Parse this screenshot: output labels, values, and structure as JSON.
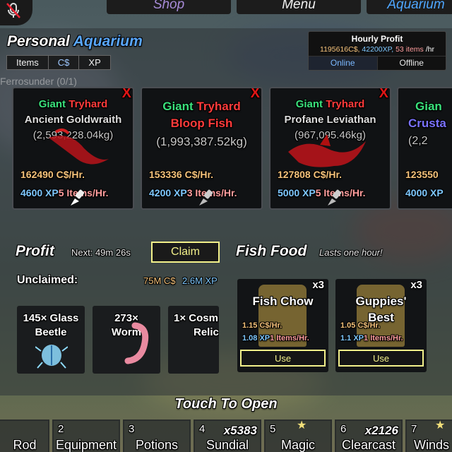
{
  "nav": {
    "shop_label": "Shop",
    "menu_label": "Menu",
    "aquarium_label": "Aquarium"
  },
  "aquarium": {
    "title_personal": "Personal",
    "title_aquarium": "Aquarium",
    "tabs": [
      "Items",
      "C$",
      "XP"
    ],
    "quest_text": "Ferrosunder (0/1)"
  },
  "hourly": {
    "title": "Hourly Profit",
    "cash": "1195616C$,",
    "xp": "42200XP,",
    "items": "53 items",
    "per": "/hr",
    "online_label": "Online",
    "offline_label": "Offline"
  },
  "fish_cards": [
    {
      "mutation1": "Giant",
      "mutation2": "Tryhard",
      "name": "Ancient Goldwraith",
      "weight": "(2,5​93,228.04kg)",
      "profit": "162490 C$/Hr.",
      "xp": "4600 XP",
      "items": "5 Items/Hr.",
      "close": "X"
    },
    {
      "mutation1": "Giant",
      "mutation2": "Tryhard",
      "name": "Bloop Fish",
      "weight": "(1,993,387.52kg)",
      "profit": "153336 C$/Hr.",
      "xp": "4200 XP",
      "items": "3 Items/Hr.",
      "close": "X"
    },
    {
      "mutation1": "Giant",
      "mutation2": "Tryhard",
      "name": "Profane Leviathan",
      "weight": "(967,095.46kg)",
      "profit": "127808 C$/Hr.",
      "xp": "5000 XP",
      "items": "5 Items/Hr.",
      "close": "X"
    },
    {
      "mutation1": "Gian",
      "mutation2": "",
      "name": "Crusta",
      "weight": "(2,2",
      "profit": "123550",
      "xp": "4000 XP",
      "items": "",
      "close": ""
    }
  ],
  "profit": {
    "title": "Profit",
    "next": "Next: 49m 26s",
    "claim_label": "Claim",
    "unclaimed_label": "Unclaimed:",
    "unclaimed_cash": "75M C$",
    "unclaimed_xp": "2.6M XP",
    "loot": [
      {
        "line1": "145× Glass",
        "line2": "Beetle"
      },
      {
        "line1": "273×",
        "line2": "Worm"
      },
      {
        "line1": "1× Cosm",
        "line2": "Relic"
      }
    ]
  },
  "fish_food": {
    "title": "Fish Food",
    "subtitle": "Lasts one hour!",
    "items": [
      {
        "qty": "x3",
        "name": "Fish Chow",
        "cash": "1.15 C$/Hr.",
        "xp": "1.08 XP",
        "items": "1 Items/Hr.",
        "use": "Use"
      },
      {
        "qty": "x3",
        "name": "Guppies' Best",
        "cash": "1.05 C$/Hr.",
        "xp": "1.1 XP",
        "items": "1 Items/Hr.",
        "use": "Use"
      }
    ]
  },
  "touch_to_open": "Touch To Open",
  "hotbar": [
    {
      "num": "",
      "name": "Rod",
      "count": ""
    },
    {
      "num": "2",
      "name": "Equipment",
      "count": ""
    },
    {
      "num": "3",
      "name": "Potions",
      "count": ""
    },
    {
      "num": "4",
      "name": "Sundial",
      "count": "x5383"
    },
    {
      "num": "5",
      "name": "Magic",
      "count": ""
    },
    {
      "num": "6",
      "name": "Clearcast",
      "count": "x2126"
    },
    {
      "num": "7",
      "name": "Winds",
      "count": ""
    }
  ],
  "colors": {
    "accent_yellow": "#f3f18a",
    "cash": "#f5c27a",
    "xp": "#7ec8ff",
    "items": "#ff9d9d",
    "giant": "#3ae07c",
    "tryhard": "#ff3b3b",
    "aquarium_blue": "#5aa8ff"
  }
}
